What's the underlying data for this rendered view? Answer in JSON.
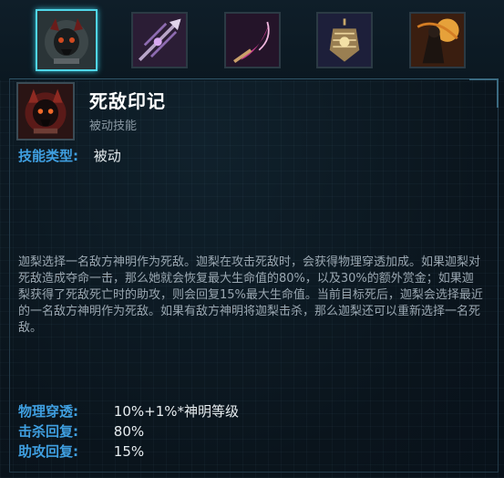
{
  "abilities": [
    {
      "icon": "death-mark-skull-icon",
      "active": true
    },
    {
      "icon": "crossbow-icon",
      "active": false
    },
    {
      "icon": "scythe-icon",
      "active": false
    },
    {
      "icon": "lantern-icon",
      "active": false
    },
    {
      "icon": "reaper-figure-icon",
      "active": false
    }
  ],
  "detail": {
    "icon": "death-mark-skull-icon",
    "name": "死敌印记",
    "subtitle": "被动技能",
    "type_label": "技能类型:",
    "type_value": "被动",
    "description": "迦梨选择一名敌方神明作为死敌。迦梨在攻击死敌时，会获得物理穿透加成。如果迦梨对死敌造成夺命一击，那么她就会恢复最大生命值的80%，以及30%的额外赏金；如果迦梨获得了死敌死亡时的助攻，则会回复15%最大生命值。当前目标死后，迦梨会选择最近的一名敌方神明作为死敌。如果有敌方神明将迦梨击杀，那么迦梨还可以重新选择一名死敌。",
    "stats": [
      {
        "label": "物理穿透:",
        "value": "10%+1%*神明等级"
      },
      {
        "label": "击杀回复:",
        "value": "80%"
      },
      {
        "label": "助攻回复:",
        "value": "15%"
      }
    ]
  },
  "colors": {
    "label": "#3f9fe0",
    "active_border": "#4fd6e8",
    "background": "#0b1620"
  }
}
